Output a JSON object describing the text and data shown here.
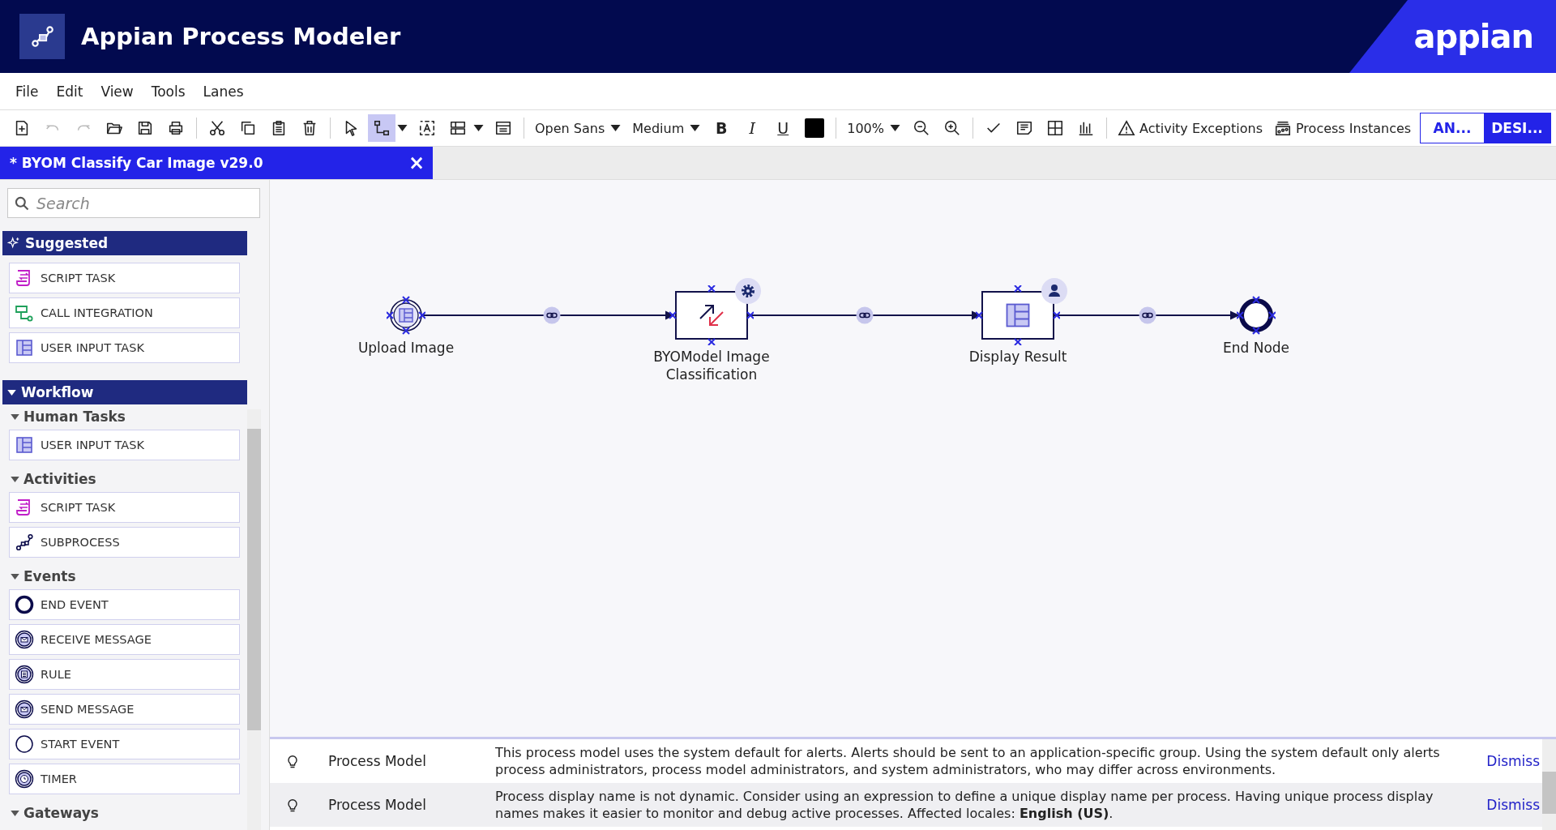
{
  "header": {
    "title": "Appian Process Modeler",
    "brand": "appian"
  },
  "menu": [
    "File",
    "Edit",
    "View",
    "Tools",
    "Lanes"
  ],
  "toolbar": {
    "history_buttons": [
      {
        "disabled": true
      },
      {
        "disabled": true
      }
    ],
    "flow_tool_selected": true,
    "font": "Open Sans",
    "size": "Medium",
    "format_buttons": [
      "B",
      "I",
      "U"
    ],
    "zoom": "100%",
    "links": [
      "Activity Exceptions",
      "Process Instances"
    ],
    "view_toggle": [
      {
        "label": "AN...",
        "selected": false
      },
      {
        "label": "DESI...",
        "selected": true
      }
    ]
  },
  "tab": {
    "title": "* BYOM Classify Car Image v29.0",
    "close": "×"
  },
  "palette": {
    "search": {
      "placeholder": "Search"
    },
    "suggested": {
      "title": "Suggested",
      "items": [
        {
          "label": "SCRIPT TASK",
          "kind": "script"
        },
        {
          "label": "CALL INTEGRATION",
          "kind": "integration"
        },
        {
          "label": "USER INPUT TASK",
          "kind": "form"
        }
      ]
    },
    "workflow": {
      "title": "Workflow",
      "expanded": true,
      "groups": [
        {
          "title": "Human Tasks",
          "expanded": true,
          "items": [
            {
              "label": "USER INPUT TASK",
              "kind": "form"
            }
          ]
        },
        {
          "title": "Activities",
          "expanded": true,
          "items": [
            {
              "label": "SCRIPT TASK",
              "kind": "script"
            },
            {
              "label": "SUBPROCESS",
              "kind": "subprocess"
            }
          ]
        },
        {
          "title": "Events",
          "expanded": true,
          "items": [
            {
              "label": "END EVENT",
              "kind": "end"
            },
            {
              "label": "RECEIVE MESSAGE",
              "kind": "message"
            },
            {
              "label": "RULE",
              "kind": "rule"
            },
            {
              "label": "SEND MESSAGE",
              "kind": "message"
            },
            {
              "label": "START EVENT",
              "kind": "start"
            },
            {
              "label": "TIMER",
              "kind": "timer"
            }
          ]
        },
        {
          "title": "Gateways",
          "expanded": true
        }
      ]
    }
  },
  "process": {
    "nodes": [
      {
        "label": "Upload Image",
        "kind": "start"
      },
      {
        "label": "BYOModel Image Classification",
        "kind": "script-task"
      },
      {
        "label": "Display Result",
        "kind": "user-task"
      },
      {
        "label": "End Node",
        "kind": "end"
      }
    ]
  },
  "messages": [
    {
      "source": "Process Model",
      "text": "This process model uses the system default for alerts. Alerts should be sent to an application-specific group. Using the system default only alerts process administrators, process model administrators, and system administrators, who may differ across environments.",
      "action": "Dismiss"
    },
    {
      "source": "Process Model",
      "text": "Process display name is not dynamic. Consider using an expression to define a unique display name per process. Having unique process display names makes it easier to monitor and debug active processes. Affected locales: **English (US)**.",
      "action": "Dismiss"
    }
  ]
}
